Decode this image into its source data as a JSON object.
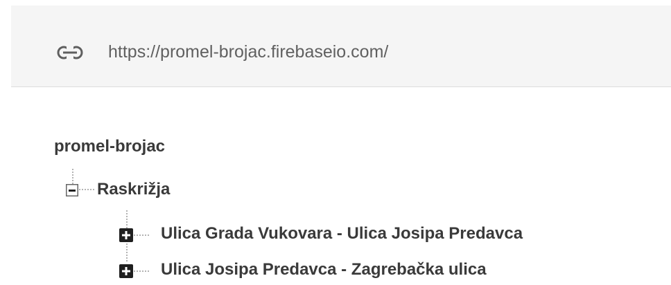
{
  "url_bar": {
    "icon": "link-icon",
    "url": "https://promel-brojac.firebaseio.com/"
  },
  "tree": {
    "root": "promel-brojac",
    "node": {
      "label": "Raskrižja",
      "toggle": "collapse",
      "children": [
        {
          "label": "Ulica Grada Vukovara - Ulica Josipa Predavca",
          "toggle": "expand"
        },
        {
          "label": "Ulica Josipa Predavca - Zagrebačka  ulica",
          "toggle": "expand"
        }
      ]
    }
  },
  "colors": {
    "bar_bg": "#f5f5f5",
    "text": "#3a3a3a",
    "url_text": "#606060",
    "toggle_fill": "#1f1f1f",
    "connector": "#999999"
  }
}
